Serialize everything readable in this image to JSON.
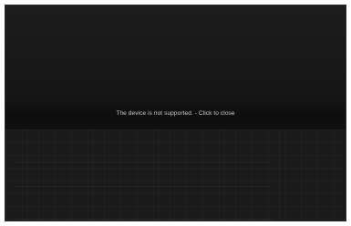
{
  "overlay": {
    "message": "The device is not supported. - Click to close"
  },
  "colors": {
    "background": "#1b1b1b",
    "text": "#cfcfcf"
  }
}
